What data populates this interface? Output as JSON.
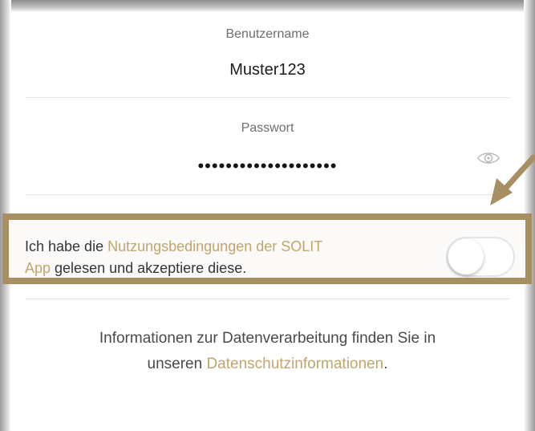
{
  "username": {
    "label": "Benutzername",
    "value": "Muster123"
  },
  "password": {
    "label": "Passwort",
    "masked_value": "••••••••••••••••••••",
    "toggle_icon": "eye-icon"
  },
  "terms": {
    "text_before": "Ich habe die ",
    "link": "Nutzungsbedingungen der SOLIT App",
    "link_line1": "Nutzungsbedingungen der SOLIT",
    "link_line2": "App",
    "text_after": " gelesen und akzeptiere diese.",
    "accepted": false
  },
  "info": {
    "text_line1": "Informationen zur Datenverarbeitung finden Sie in",
    "text_prefix": "unseren ",
    "link": "Datenschutzinformationen",
    "text_suffix": "."
  },
  "colors": {
    "accent_gold": "#c2a46c",
    "highlight_box": "#a88f63",
    "text": "#353535"
  }
}
